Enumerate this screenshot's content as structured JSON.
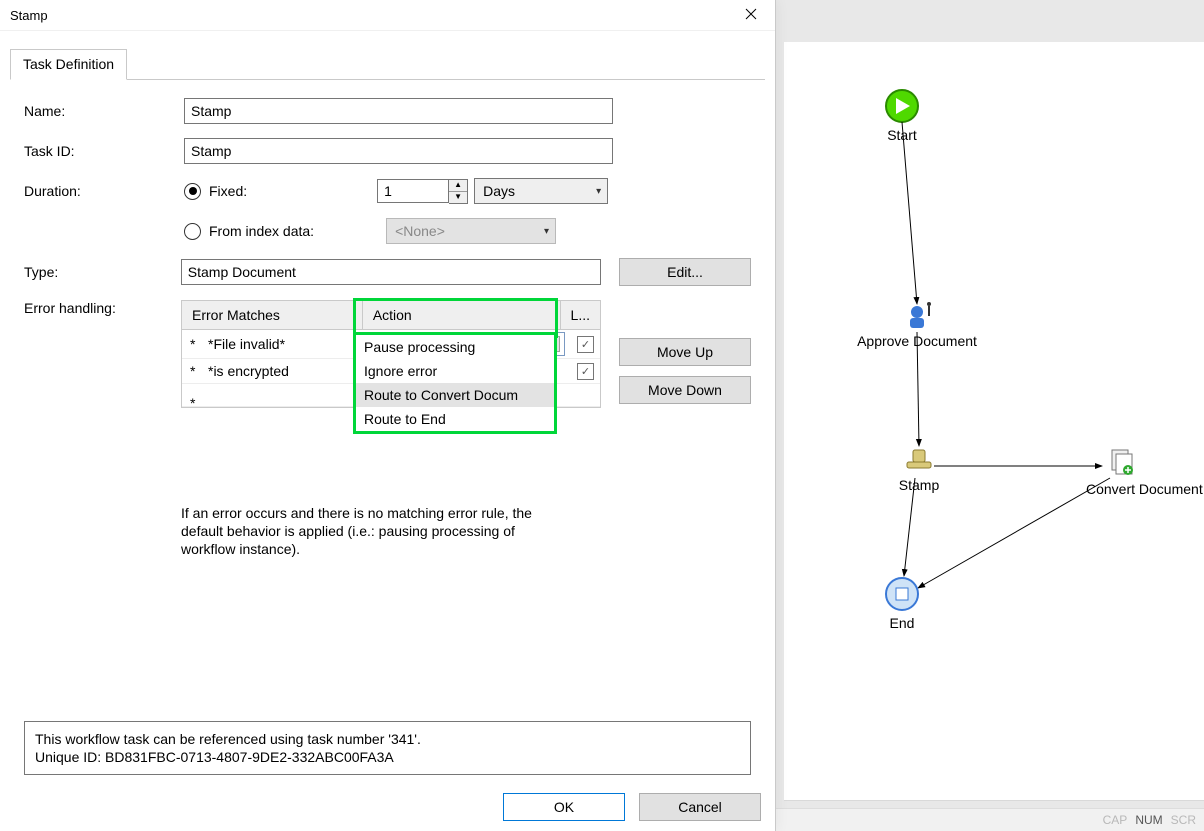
{
  "dialog": {
    "title": "Stamp",
    "tab_label": "Task Definition",
    "labels": {
      "name": "Name:",
      "task_id": "Task ID:",
      "duration": "Duration:",
      "type": "Type:",
      "error_handling": "Error handling:"
    },
    "fields": {
      "name_value": "Stamp",
      "task_id_value": "Stamp",
      "duration_fixed_label": "Fixed:",
      "duration_value": "1",
      "duration_unit": "Days",
      "from_index_label": "From index data:",
      "from_index_value": "<None>",
      "type_value": "Stamp Document"
    },
    "buttons": {
      "edit": "Edit...",
      "move_up": "Move Up",
      "move_down": "Move Down",
      "ok": "OK",
      "cancel": "Cancel"
    },
    "error_table": {
      "col_error": "Error Matches",
      "col_action": "Action",
      "col_l": "L...",
      "rows": [
        {
          "error": "*File invalid*",
          "action": "Route to Convert Docu",
          "checked": true
        },
        {
          "error": "*is encrypted",
          "action": "",
          "checked": true
        }
      ],
      "dropdown_options": [
        "Pause processing",
        "Ignore error",
        "Route to Convert Docum",
        "Route to End"
      ],
      "dropdown_selected_index": 2
    },
    "note_text": "If an error occurs and there is no matching error rule, the default behavior is applied (i.e.: pausing processing of workflow instance).",
    "info_line1": "This workflow task can be referenced using task number '341'.",
    "info_line2": "Unique ID: BD831FBC-0713-4807-9DE2-332ABC00FA3A"
  },
  "workflow": {
    "nodes": {
      "start": "Start",
      "approve": "Approve Document",
      "stamp": "Stamp",
      "convert": "Convert Document to PDF",
      "end": "End"
    }
  },
  "statusbar": {
    "cap": "CAP",
    "num": "NUM",
    "scr": "SCR"
  }
}
